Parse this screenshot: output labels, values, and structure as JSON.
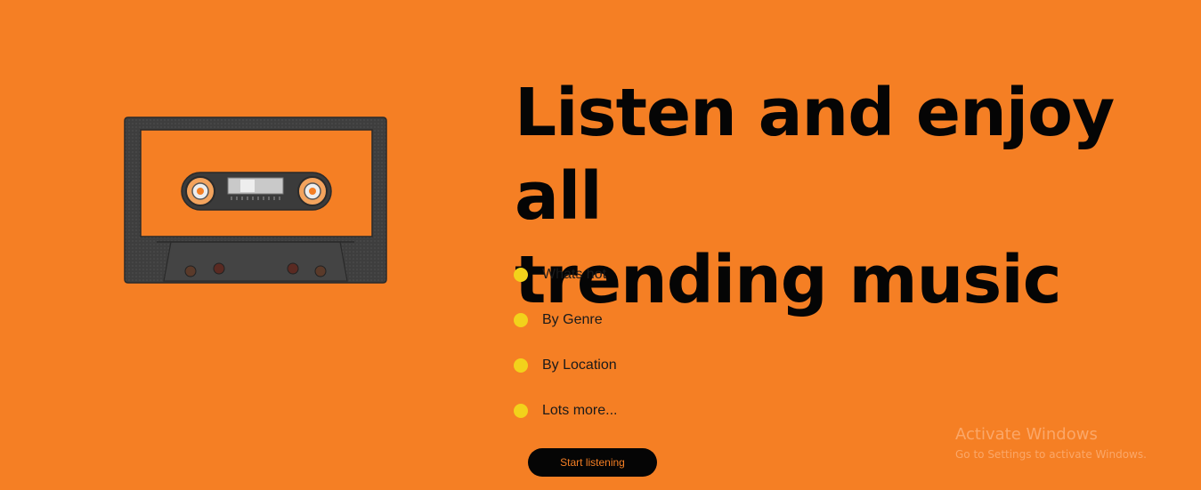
{
  "hero": {
    "headline_line1": "Listen and enjoy all",
    "headline_line2": "trending music",
    "image_icon": "cassette-tape-icon"
  },
  "features": [
    {
      "label": "Whats hot"
    },
    {
      "label": "By Genre"
    },
    {
      "label": "By Location"
    },
    {
      "label": "Lots more..."
    }
  ],
  "cta": {
    "label": "Start listening"
  },
  "watermark": {
    "title": "Activate Windows",
    "subtitle": "Go to Settings to activate Windows."
  },
  "colors": {
    "background": "#f57f24",
    "bullet": "#f2d21b",
    "button_bg": "#050505",
    "button_text": "#f57f24",
    "cassette_body": "#3d3d3d"
  }
}
